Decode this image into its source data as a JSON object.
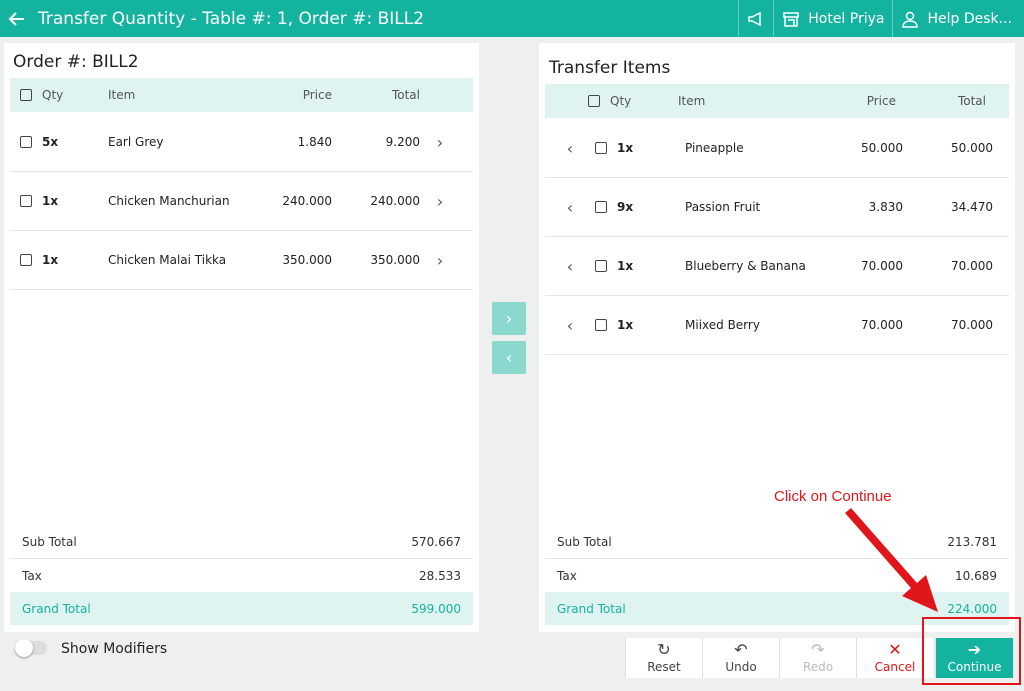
{
  "header": {
    "back_icon": "arrow-left-icon",
    "title": "Transfer Quantity - Table #: 1, Order #: BILL2",
    "hotel": "Hotel Priya",
    "help": "Help Desk...",
    "bg_color": "#14b3a0"
  },
  "left": {
    "title": "Order #: BILL2",
    "columns": {
      "qty": "Qty",
      "item": "Item",
      "price": "Price",
      "total": "Total"
    },
    "rows": [
      {
        "qty": "5x",
        "item": "Earl Grey",
        "price": "1.840",
        "total": "9.200"
      },
      {
        "qty": "1x",
        "item": "Chicken Manchurian",
        "price": "240.000",
        "total": "240.000"
      },
      {
        "qty": "1x",
        "item": "Chicken Malai Tikka",
        "price": "350.000",
        "total": "350.000"
      }
    ],
    "totals": {
      "sub_label": "Sub Total",
      "sub": "570.667",
      "tax_label": "Tax",
      "tax": "28.533",
      "grand_label": "Grand Total",
      "grand": "599.000"
    }
  },
  "right": {
    "title": "Transfer Items",
    "columns": {
      "qty": "Qty",
      "item": "Item",
      "price": "Price",
      "total": "Total"
    },
    "rows": [
      {
        "qty": "1x",
        "item": "Pineapple",
        "price": "50.000",
        "total": "50.000"
      },
      {
        "qty": "9x",
        "item": "Passion Fruit",
        "price": "3.830",
        "total": "34.470"
      },
      {
        "qty": "1x",
        "item": "Blueberry & Banana",
        "price": "70.000",
        "total": "70.000"
      },
      {
        "qty": "1x",
        "item": "Miixed Berry",
        "price": "70.000",
        "total": "70.000"
      }
    ],
    "totals": {
      "sub_label": "Sub Total",
      "sub": "213.781",
      "tax_label": "Tax",
      "tax": "10.689",
      "grand_label": "Grand Total",
      "grand": "224.000"
    }
  },
  "toggle": {
    "label": "Show Modifiers",
    "on": false
  },
  "actions": {
    "reset": "Reset",
    "undo": "Undo",
    "redo": "Redo",
    "cancel": "Cancel",
    "continue": "Continue"
  },
  "annotation": {
    "text": "Click on Continue",
    "color": "#e0161b"
  }
}
